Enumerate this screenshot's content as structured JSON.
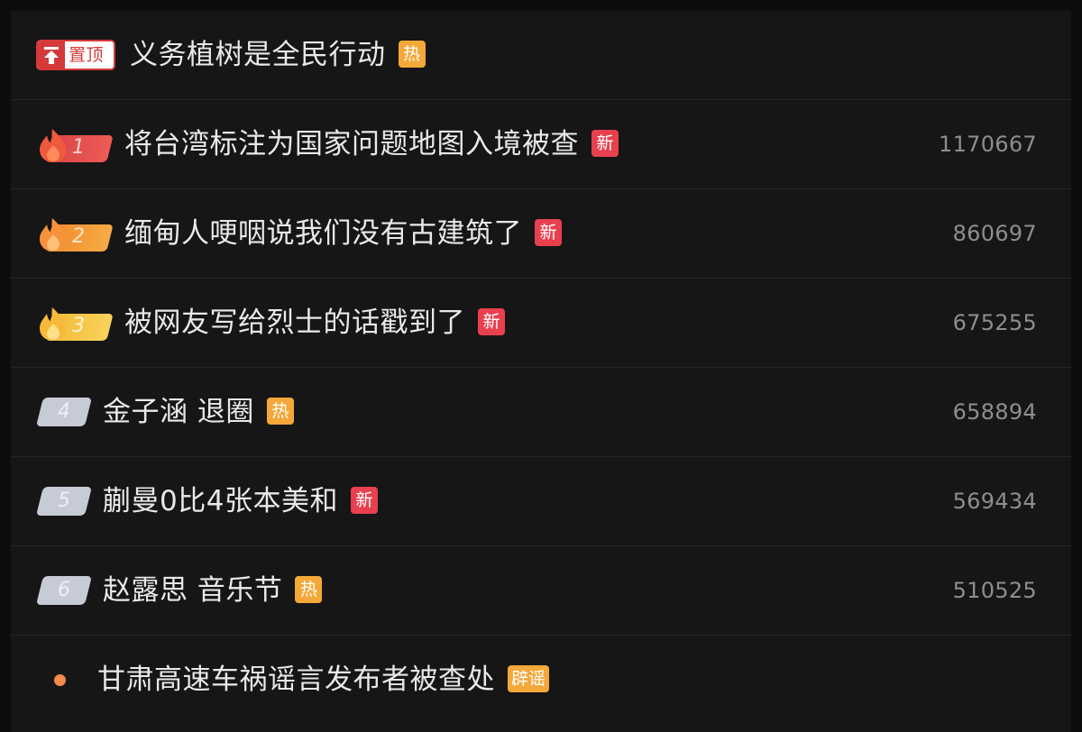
{
  "pinned": {
    "badge_label": "置顶",
    "title": "义务植树是全民行动",
    "tag": "热"
  },
  "items": [
    {
      "rank": "1",
      "title": "将台湾标注为国家问题地图入境被查",
      "tag": "新",
      "tag_type": "new",
      "count": "1170667",
      "badge_color": "#e8484a",
      "flame_color": "#f05a3c"
    },
    {
      "rank": "2",
      "title": "缅甸人哽咽说我们没有古建筑了",
      "tag": "新",
      "tag_type": "new",
      "count": "860697",
      "badge_color": "#f59b35",
      "flame_color": "#f7923a"
    },
    {
      "rank": "3",
      "title": "被网友写给烈士的话戳到了",
      "tag": "新",
      "tag_type": "new",
      "count": "675255",
      "badge_color": "#f5c342",
      "flame_color": "#f6b93b"
    },
    {
      "rank": "4",
      "title": "金子涵 退圈",
      "tag": "热",
      "tag_type": "hot",
      "count": "658894"
    },
    {
      "rank": "5",
      "title": "蒯曼0比4张本美和",
      "tag": "新",
      "tag_type": "new",
      "count": "569434"
    },
    {
      "rank": "6",
      "title": "赵露思 音乐节",
      "tag": "热",
      "tag_type": "hot",
      "count": "510525"
    }
  ],
  "rumor": {
    "title": "甘肃高速车祸谣言发布者被查处",
    "tag": "辟谣",
    "dot_color": "#f58a4b"
  }
}
